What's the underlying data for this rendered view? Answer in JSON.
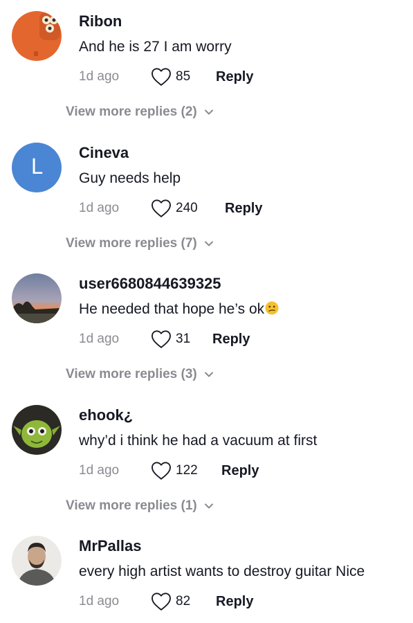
{
  "comments": [
    {
      "username": "Ribon",
      "text": "And he is 27 I am worry",
      "time": "1d ago",
      "likes": "85",
      "reply_label": "Reply",
      "more_replies": "View more replies (2)"
    },
    {
      "username": "Cineva",
      "text": "Guy needs help",
      "time": "1d ago",
      "likes": "240",
      "reply_label": "Reply",
      "more_replies": "View more replies (7)",
      "avatar_letter": "L"
    },
    {
      "username": "user6680844639325",
      "text": "He needed that hope he’s ok",
      "time": "1d ago",
      "likes": "31",
      "reply_label": "Reply",
      "more_replies": "View more replies (3)"
    },
    {
      "username": "ehook¿",
      "text": "why’d i think he had a vacuum at first",
      "time": "1d ago",
      "likes": "122",
      "reply_label": "Reply",
      "more_replies": "View more replies (1)"
    },
    {
      "username": "MrPallas",
      "text": "every high artist wants to destroy guitar Nice",
      "time": "1d ago",
      "likes": "82",
      "reply_label": "Reply"
    }
  ],
  "colors": {
    "primary_text": "#161823",
    "secondary_text": "#8a8b91",
    "letter_avatar_bg": "#4a86d4"
  },
  "icons": {
    "like": "heart-outline-icon",
    "expand": "chevron-down-icon",
    "emoji": "confused-face-emoji"
  }
}
